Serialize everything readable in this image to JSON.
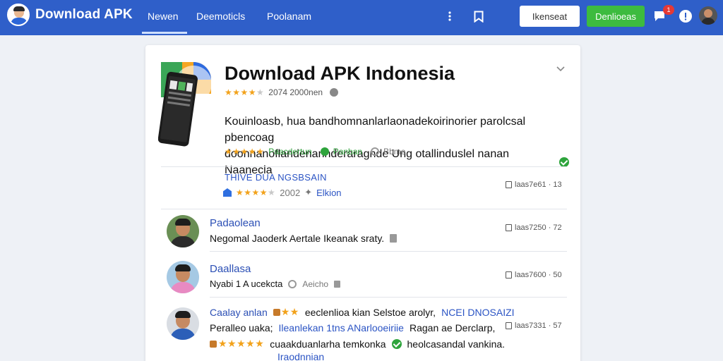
{
  "header": {
    "brand": "Download APK",
    "tabs": [
      {
        "label": "Newen",
        "active": true
      },
      {
        "label": "Deemoticls",
        "active": false
      },
      {
        "label": "Poolanam",
        "active": false
      }
    ],
    "outline_button": "Ikenseat",
    "green_button": "Denlioeas",
    "notification_count": "1"
  },
  "app": {
    "title": "Download APK Indonesia",
    "rating_text": "2074 2000nen",
    "description_line1": "Kouinloasb, hua bandhomnanlarlaonadekoirinorier parolcsal pbencoag",
    "description_line2": "doonnanoflandenanhderaragnde Ung otallinduslel nanan Naanecla",
    "tag_green": "Paacdertun",
    "tag_green2": "Panban",
    "tag_grey": "Bbme"
  },
  "version": {
    "label": "THIVE DUA NGSBSAIN",
    "year": "2002",
    "edition_link": "Elkion",
    "meta": "laas7e61 · 13"
  },
  "reviews": [
    {
      "name": "Padaolean",
      "text": "Negomal Jaoderk Aertale Ikeanak sraty.",
      "meta": "laas7250 · 72"
    },
    {
      "name": "Daallasa",
      "text": "Nyabi 1 A ucekcta",
      "extra": "Aeicho",
      "meta": "laas7600 · 50"
    },
    {
      "name": "Caalay anlan",
      "name_extra": "eeclenlioa kian Selstoe arolyr,",
      "name_link": "NCEI DNOSAIZI",
      "text_start": "Peralleo uaka;",
      "text_link": "Ileanlekan 1tns ANarlooeiriie",
      "text_end": "Ragan ae Derclarp,",
      "text_line3": "cuaakduanlarha temkonka",
      "text_line3_end": "heolcasandal vankina.",
      "text_line4": "Iraodnnian",
      "meta": "laas7331 · 57"
    }
  ],
  "colors": {
    "header": "#2f5fc9",
    "green": "#3dbb3f",
    "link": "#2b54c4",
    "star": "#f2a21b"
  }
}
